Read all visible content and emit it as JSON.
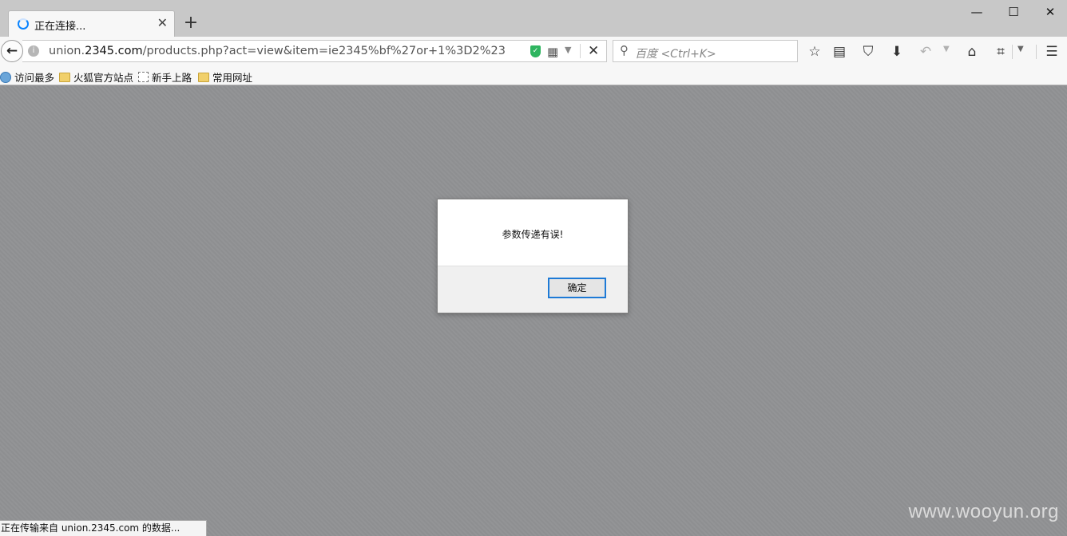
{
  "tab": {
    "title": "正在连接..."
  },
  "window_controls": {
    "minimize": "—",
    "maximize": "☐",
    "close": "✕"
  },
  "urlbar": {
    "url_prefix": "union.",
    "url_domain": "2345.com",
    "url_path": "/products.php?act=view&item=ie2345%bf%27or+1%3D2%23"
  },
  "searchbar": {
    "placeholder": "百度 <Ctrl+K>"
  },
  "bookmarks": [
    {
      "label": "访问最多",
      "icon": "magnifier-icon"
    },
    {
      "label": "火狐官方站点",
      "icon": "folder-icon"
    },
    {
      "label": "新手上路",
      "icon": "dashed-page-icon"
    },
    {
      "label": "常用网址",
      "icon": "folder-icon"
    }
  ],
  "dialog": {
    "message": "参数传递有误!",
    "ok_label": "确定"
  },
  "status_bar": {
    "text": "正在传输来自 union.2345.com 的数据..."
  },
  "watermark": "www.wooyun.org",
  "colors": {
    "accent": "#1e7ad6",
    "overlay": "#8f9092",
    "chrome": "#f7f7f7"
  }
}
